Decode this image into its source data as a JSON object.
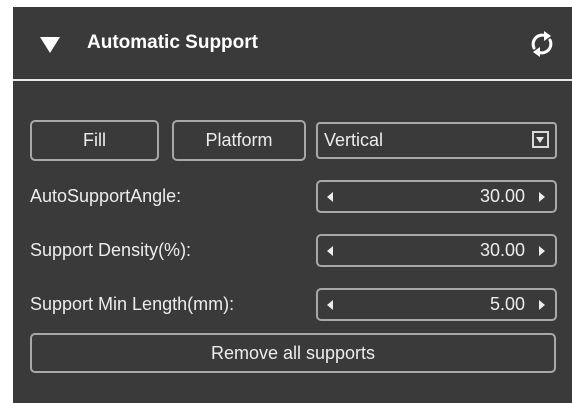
{
  "header": {
    "title": "Automatic Support",
    "collapse_icon": "triangle-down-icon",
    "refresh_icon": "refresh-icon"
  },
  "actions": {
    "fill_label": "Fill",
    "platform_label": "Platform",
    "orientation": {
      "selected": "Vertical"
    },
    "remove_all_label": "Remove all supports"
  },
  "fields": [
    {
      "label": "AutoSupportAngle:",
      "value": "30.00"
    },
    {
      "label": "Support Density(%):",
      "value": "30.00"
    },
    {
      "label": "Support Min Length(mm):",
      "value": "5.00"
    }
  ],
  "colors": {
    "panel_bg": "#3a3a3a",
    "border": "#a8a8a8",
    "text": "#ececec",
    "divider": "#e6e6e6"
  }
}
